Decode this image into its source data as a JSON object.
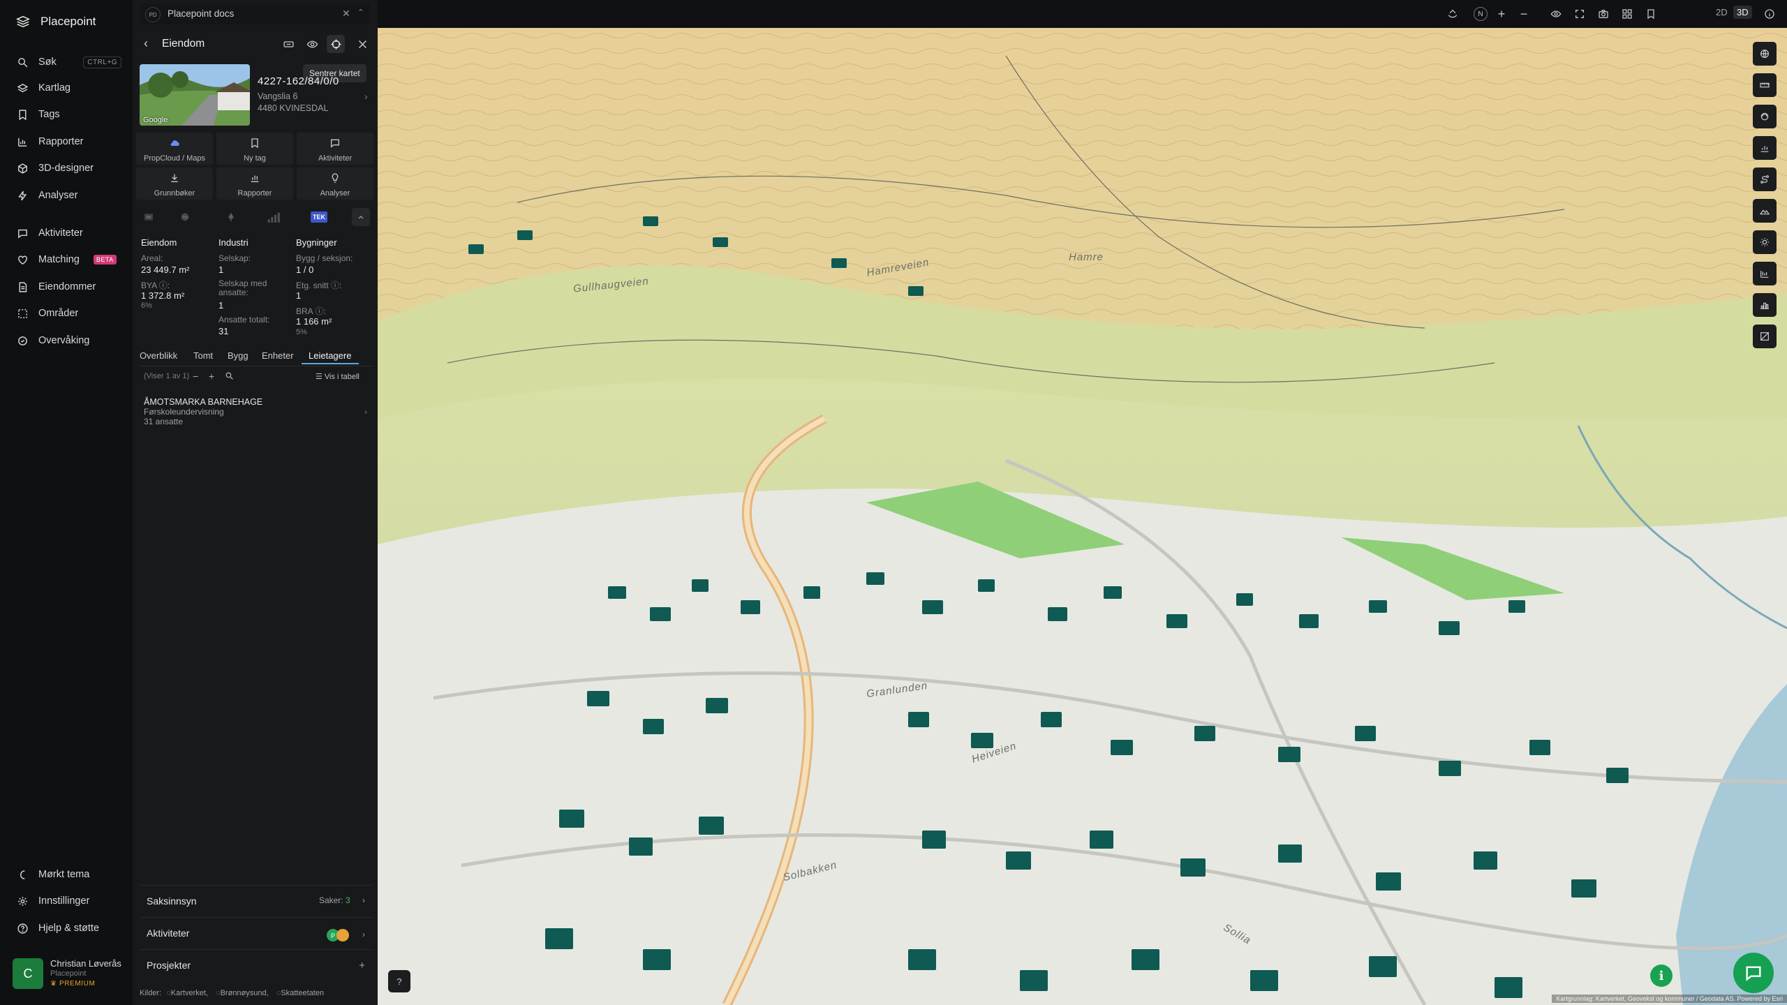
{
  "app": {
    "name": "Placepoint"
  },
  "nav": {
    "items": [
      {
        "label": "Søk",
        "shortcut": "CTRL+G",
        "icon": "search-icon"
      },
      {
        "label": "Kartlag",
        "icon": "layers-icon"
      },
      {
        "label": "Tags",
        "icon": "bookmark-icon"
      },
      {
        "label": "Rapporter",
        "icon": "chart-icon"
      },
      {
        "label": "3D-designer",
        "icon": "cube-icon"
      },
      {
        "label": "Analyser",
        "icon": "bolt-icon"
      },
      {
        "label": "Aktiviteter",
        "icon": "chat-icon"
      },
      {
        "label": "Matching",
        "badge": "BETA",
        "icon": "heart-icon"
      },
      {
        "label": "Eiendommer",
        "icon": "document-icon"
      },
      {
        "label": "Områder",
        "icon": "area-icon"
      },
      {
        "label": "Overvåking",
        "icon": "monitor-icon"
      }
    ],
    "bottom": [
      {
        "label": "Mørkt tema",
        "icon": "moon-icon"
      },
      {
        "label": "Innstillinger",
        "icon": "gear-icon"
      },
      {
        "label": "Hjelp & støtte",
        "icon": "help-icon"
      }
    ],
    "user": {
      "initial": "C",
      "name": "Christian Løverås",
      "org": "Placepoint",
      "plan": "PREMIUM"
    }
  },
  "tab": {
    "badge": "PD",
    "title": "Placepoint docs"
  },
  "panel": {
    "title": "Eiendom",
    "tooltip": "Sentrer kartet",
    "photo_label": "Google",
    "address": {
      "id": "4227-162/84/0/0",
      "street": "Vangslia 6",
      "postal": "4480 KVINESDAL"
    },
    "actions": [
      {
        "label": "PropCloud / Maps",
        "icon": "cloud-icon"
      },
      {
        "label": "Ny tag",
        "icon": "bookmark-icon"
      },
      {
        "label": "Aktiviteter",
        "icon": "chat-icon"
      },
      {
        "label": "Grunnbøker",
        "icon": "download-icon"
      },
      {
        "label": "Rapporter",
        "icon": "chart-icon"
      },
      {
        "label": "Analyser",
        "icon": "bulb-icon"
      }
    ],
    "mini_icons": [
      "flag-icon",
      "globe-icon",
      "tree-icon",
      "bars-icon",
      "TEK",
      "chevron-up-icon"
    ],
    "columns": {
      "eiendom": {
        "title": "Eiendom",
        "areal_label": "Areal:",
        "areal_value": "23 449.7 m²",
        "bya_label": "BYA ⓘ:",
        "bya_value": "1 372.8 m²",
        "bya_pct": "6%"
      },
      "industri": {
        "title": "Industri",
        "selskap_label": "Selskap:",
        "selskap_value": "1",
        "ansatte_label": "Selskap med ansatte:",
        "ansatte_value": "1",
        "totalt_label": "Ansatte totalt:",
        "totalt_value": "31"
      },
      "bygninger": {
        "title": "Bygninger",
        "bygg_label": "Bygg / seksjon:",
        "bygg_value": "1 / 0",
        "etg_label": "Etg. snitt ⓘ:",
        "etg_value": "1",
        "bra_label": "BRA ⓘ:",
        "bra_value": "1 166 m²",
        "bra_pct": "5%"
      }
    },
    "subtabs": [
      "Overblikk",
      "Tomt",
      "Bygg",
      "Enheter",
      "Leietagere"
    ],
    "active_subtab": "Leietagere",
    "list_count": "(Viser 1 av 1)",
    "table_toggle": "Vis i tabell",
    "tenant": {
      "name": "ÅMOTSMARKA BARNEHAGE",
      "type": "Førskoleundervisning",
      "employees": "31 ansatte"
    },
    "sections": [
      {
        "label": "Saksinnsyn",
        "right_label": "Saker:",
        "right_value": "3"
      },
      {
        "label": "Aktiviteter"
      },
      {
        "label": "Prosjekter",
        "right_value": "+"
      }
    ],
    "sources": {
      "label": "Kilder:",
      "items": [
        "Kartverket,",
        "Brønnøysund,",
        "Skatteetaten"
      ]
    }
  },
  "topbar": {
    "mode_2d": "2D",
    "mode_3d": "3D",
    "compass": "N"
  },
  "map": {
    "road_labels": [
      "Hamre",
      "Granlunden",
      "Solbakken",
      "Sollia",
      "Heiveien",
      "Hamreveien",
      "Gullhaugveien"
    ],
    "attribution": "Kartgrunnlag: Kartverket, Geovekst og kommuner / Geodata AS. Powered by Esri",
    "help": "?"
  },
  "colors": {
    "accent": "#5aa9e6",
    "green": "#16a052",
    "building": "#0f5a52",
    "terrain": "#e3c78f"
  }
}
